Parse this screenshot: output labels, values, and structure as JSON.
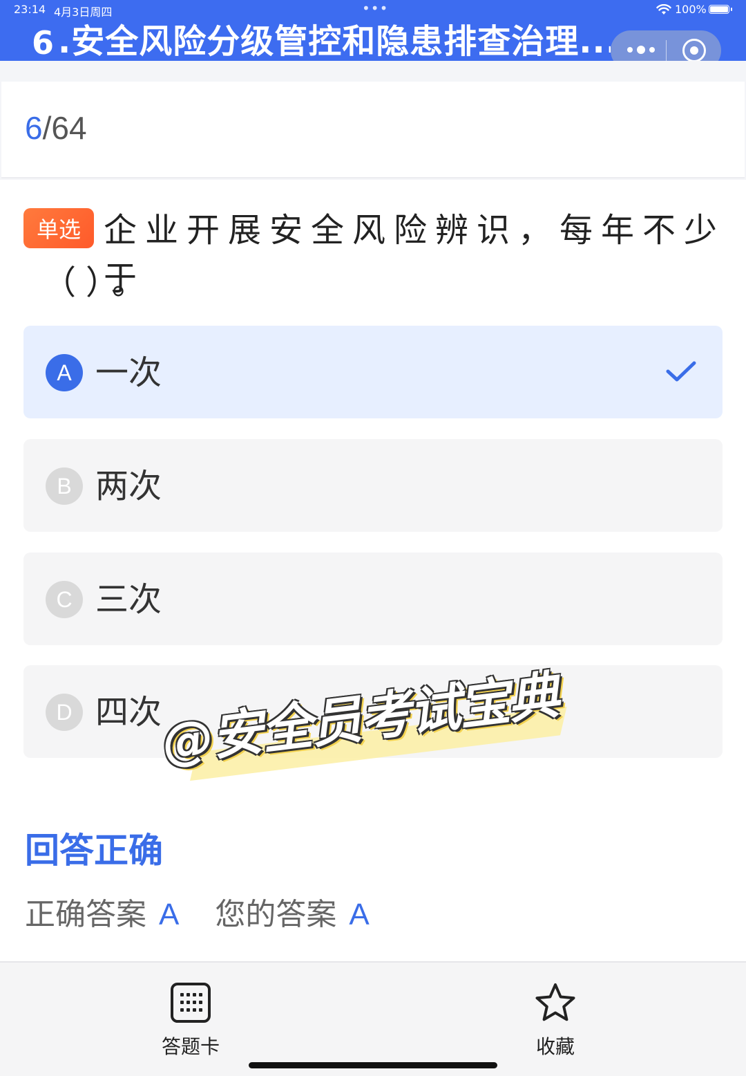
{
  "status_bar": {
    "time": "23:14",
    "date": "4月3日周四",
    "dots": "•••",
    "battery": "100%"
  },
  "header": {
    "back_icon": "6",
    "title": ".安全风险分级管控和隐患排查治理...",
    "accent_color": "#3d6cf0"
  },
  "progress": {
    "current": "6",
    "separator_total": "/64"
  },
  "question": {
    "type_badge": "单选",
    "text_line1": "企业开展安全风险辨识，每年不少于",
    "text_line2": "（）。"
  },
  "options": [
    {
      "letter": "A",
      "text": "一次",
      "selected": true
    },
    {
      "letter": "B",
      "text": "两次",
      "selected": false
    },
    {
      "letter": "C",
      "text": "三次",
      "selected": false
    },
    {
      "letter": "D",
      "text": "四次",
      "selected": false
    }
  ],
  "watermark": "@安全员考试宝典",
  "result": {
    "title": "回答正确",
    "correct_label": "正确答案",
    "correct_value": "A",
    "yours_label": "您的答案",
    "yours_value": "A"
  },
  "tab_bar": {
    "answer_card_label": "答题卡",
    "answer_card_icon": "grid-icon",
    "favorite_label": "收藏",
    "favorite_icon": "star-icon"
  }
}
